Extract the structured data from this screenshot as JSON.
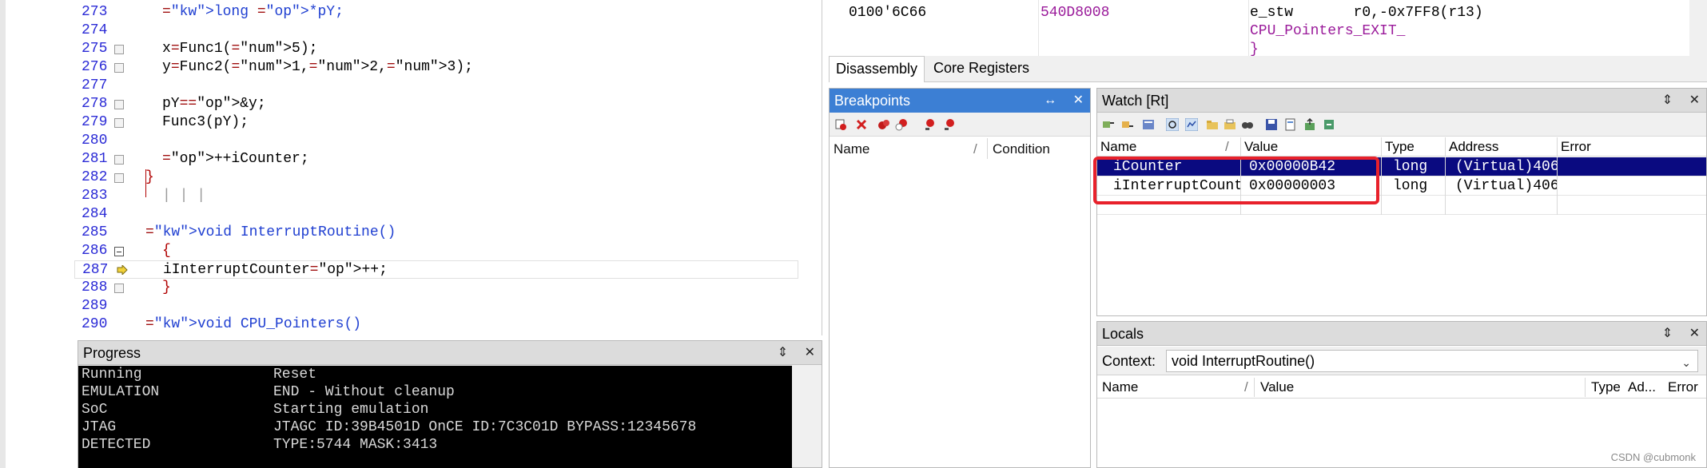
{
  "editor": {
    "lines": [
      {
        "n": "273",
        "text": "long *pY;"
      },
      {
        "n": "274",
        "text": ""
      },
      {
        "n": "275",
        "text": "x=Func1(5);"
      },
      {
        "n": "276",
        "text": "y=Func2(1,2,3);"
      },
      {
        "n": "277",
        "text": ""
      },
      {
        "n": "278",
        "text": "pY=&y;"
      },
      {
        "n": "279",
        "text": "Func3(pY);"
      },
      {
        "n": "280",
        "text": ""
      },
      {
        "n": "281",
        "text": "++iCounter;"
      },
      {
        "n": "282",
        "text": "}"
      },
      {
        "n": "283",
        "text": "| | |"
      },
      {
        "n": "284",
        "text": ""
      },
      {
        "n": "285",
        "text": "void InterruptRoutine()"
      },
      {
        "n": "286",
        "text": "{"
      },
      {
        "n": "287",
        "text": "iInterruptCounter++;"
      },
      {
        "n": "288",
        "text": "}"
      },
      {
        "n": "289",
        "text": ""
      },
      {
        "n": "290",
        "text": "void CPU_Pointers()"
      }
    ]
  },
  "progress": {
    "title": "Progress",
    "rows": [
      {
        "key": "Running",
        "value": "Reset"
      },
      {
        "key": "EMULATION",
        "value": "END - Without cleanup"
      },
      {
        "key": "SoC",
        "value": "Starting emulation"
      },
      {
        "key": "JTAG",
        "value": "JTAGC ID:39B4501D OnCE ID:7C3C01D BYPASS:12345678"
      },
      {
        "key": "DETECTED",
        "value": "TYPE:5744 MASK:3413"
      }
    ]
  },
  "disassembly": {
    "address": "0100'6C66",
    "opcode": "540D8008",
    "instruction": "e_stw       r0,-0x7FF8(r13)",
    "label": "CPU_Pointers_EXIT_",
    "brace": "}"
  },
  "tabs": {
    "disassembly": "Disassembly",
    "core_registers": "Core Registers"
  },
  "breakpoints": {
    "title": "Breakpoints",
    "col_name": "Name",
    "col_slash": "/",
    "col_condition": "Condition"
  },
  "watch": {
    "title": "Watch [Rt]",
    "headers": {
      "name": "Name",
      "slash": "/",
      "value": "Value",
      "type": "Type",
      "address": "Address",
      "error": "Error"
    },
    "rows": [
      {
        "name": "iCounter",
        "value": "0x00000B42",
        "type": "long",
        "address": "(Virtual)406"
      },
      {
        "name": "iInterruptCounter",
        "value": "0x00000003",
        "type": "long",
        "address": "(Virtual)406"
      }
    ]
  },
  "locals": {
    "title": "Locals",
    "context_label": "Context:",
    "context_value": "void InterruptRoutine()",
    "headers": {
      "name": "Name",
      "slash": "/",
      "value": "Value",
      "type": "Type",
      "address": "Ad...",
      "error": "Error"
    }
  },
  "title_buttons": {
    "pin": "⇕",
    "close": "✕",
    "arrows": "↔"
  },
  "watermark": "CSDN @cubmonk",
  "colors": {
    "selection": "#0a0a80",
    "highlight": "#e8212b",
    "keyword": "#1f3fd1",
    "active_title": "#3c7fd4"
  }
}
